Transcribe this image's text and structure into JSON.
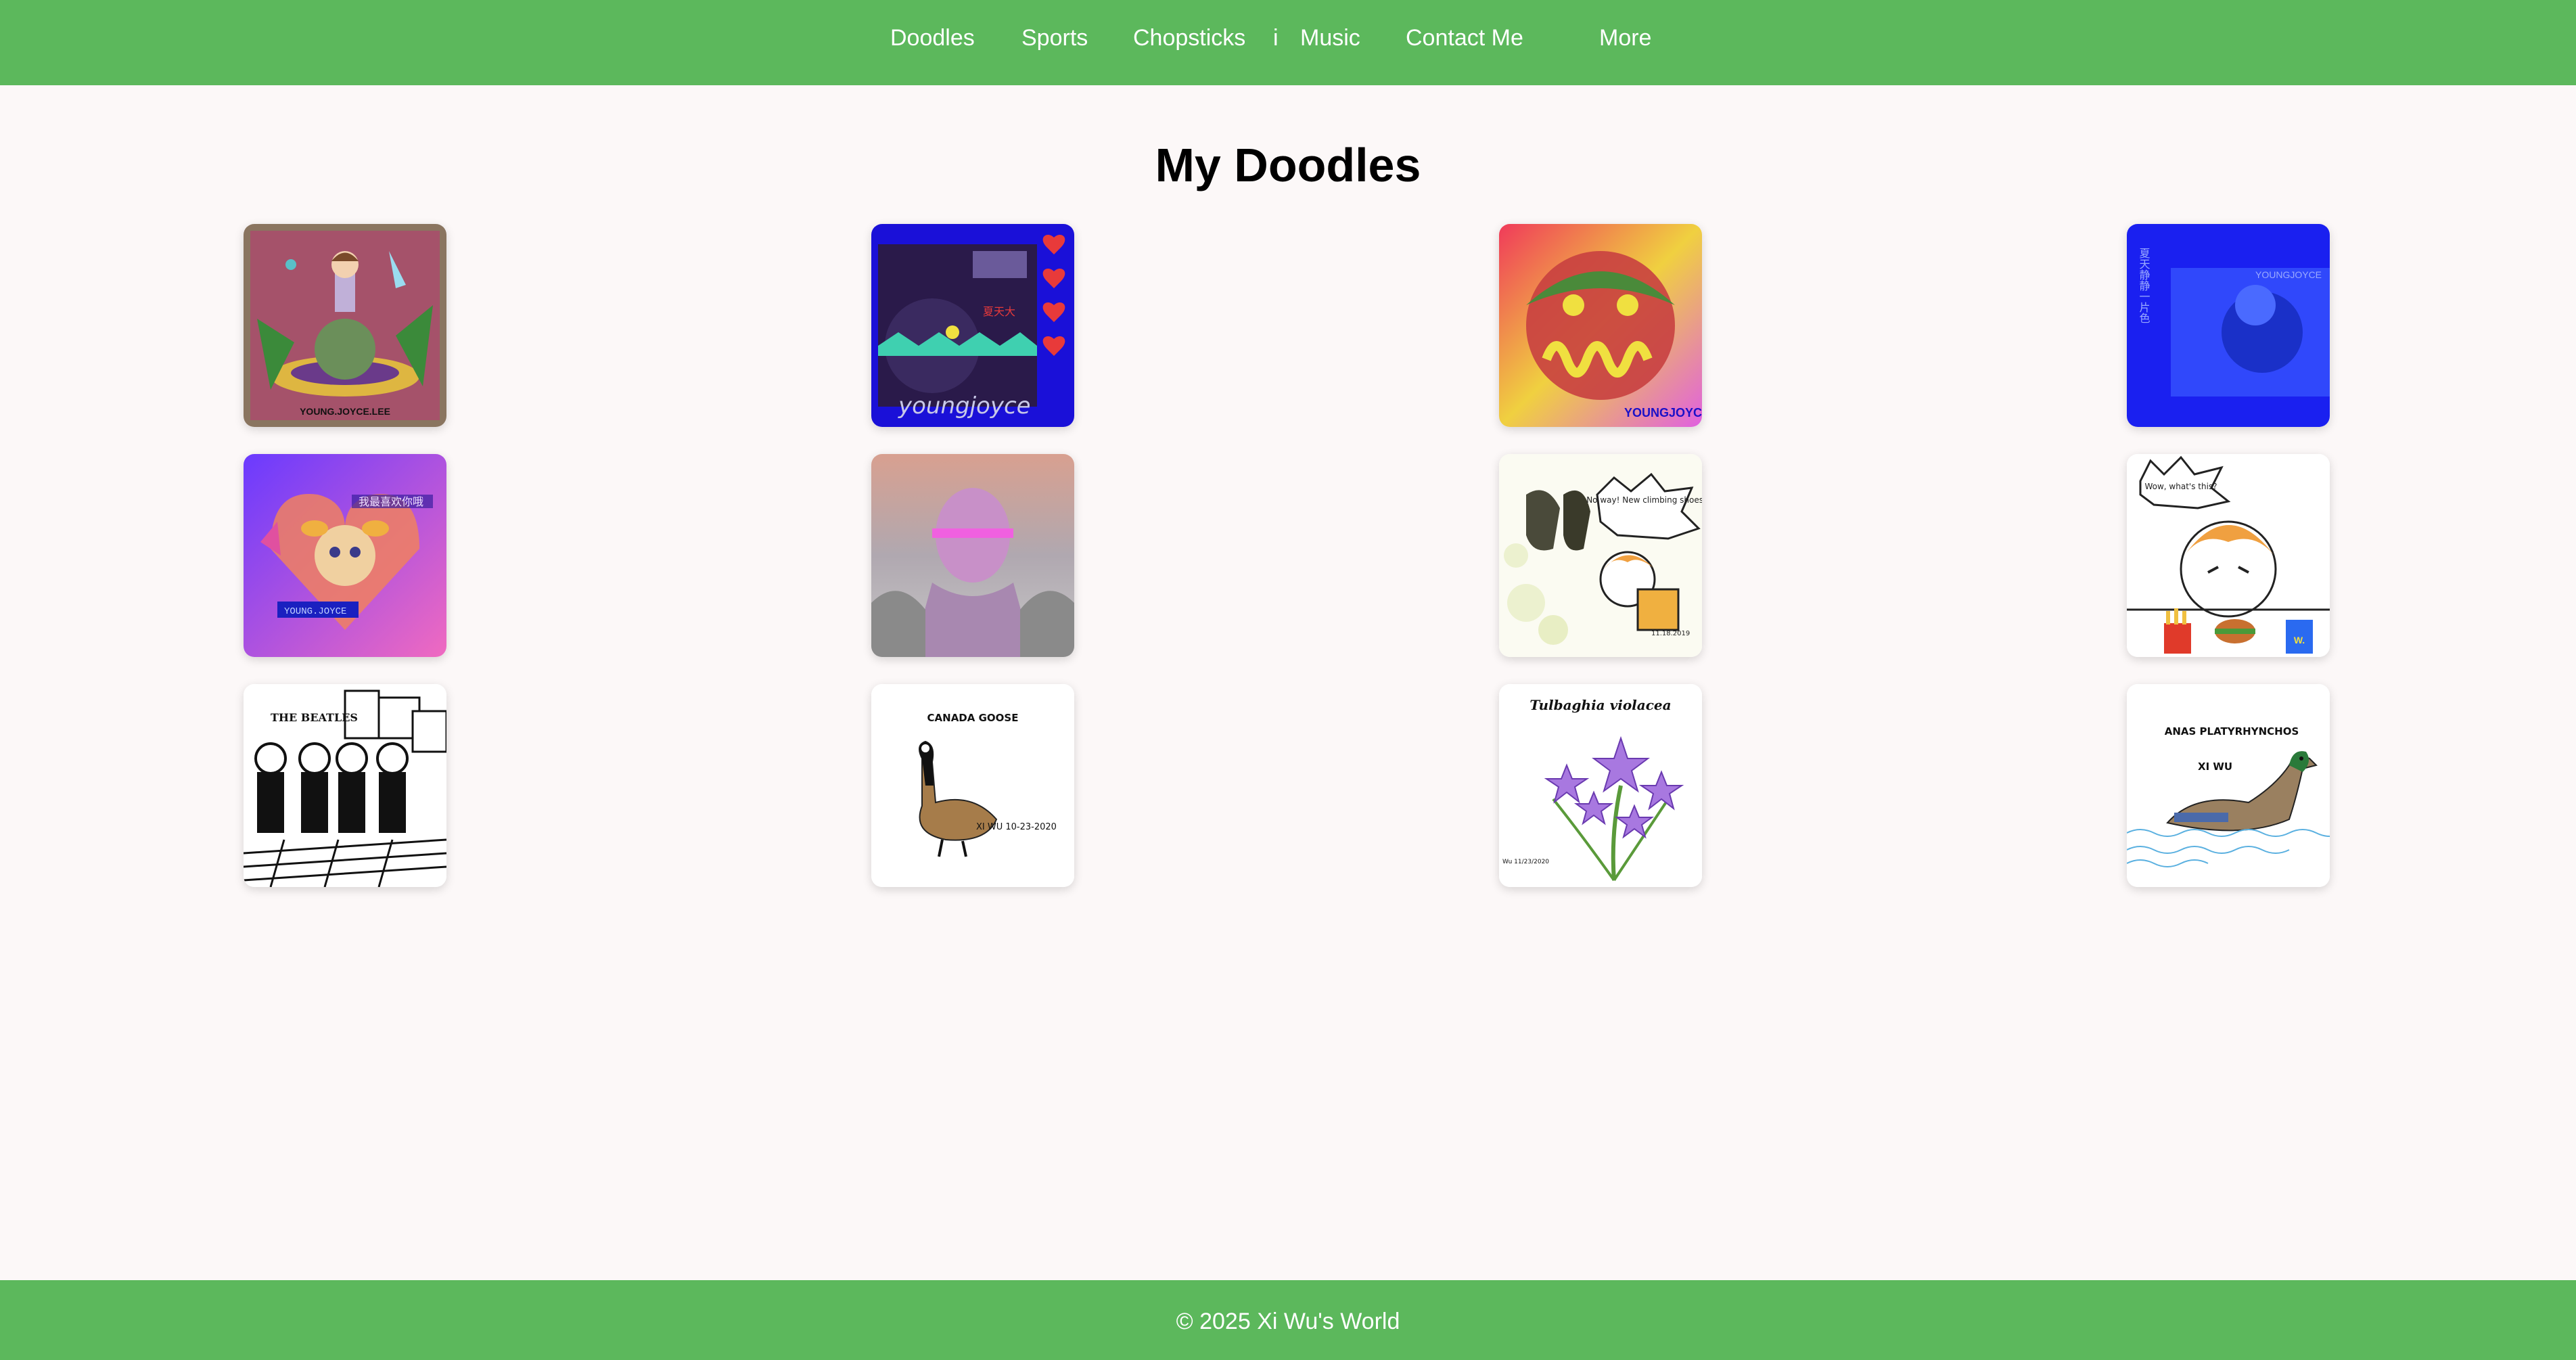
{
  "nav": {
    "items": [
      {
        "label": "Doodles"
      },
      {
        "label": "Sports"
      },
      {
        "label": "Chopsticks"
      },
      {
        "label": "Music"
      },
      {
        "label": "Contact Me"
      },
      {
        "label": "More"
      }
    ],
    "separator": "i"
  },
  "page": {
    "title": "My Doodles"
  },
  "gallery": {
    "items": [
      {
        "caption": "YOUNG.JOYCE.LEE"
      },
      {
        "caption": "youngjoyce",
        "side_text": "夏天大"
      },
      {
        "caption": "YOUNGJOYCE"
      },
      {
        "caption": "YOUNGJOYCE",
        "side_text": "夏天静静一片色"
      },
      {
        "caption": "YOUNG.JOYCE",
        "side_text": "我最喜欢你哦"
      },
      {
        "caption": ""
      },
      {
        "speech": "No way! New climbing shoes!",
        "date": "11.18.2019"
      },
      {
        "speech": "Wow, what's this?",
        "badge": "W."
      },
      {
        "caption": "THE BEATLES"
      },
      {
        "title": "CANADA GOOSE",
        "signature": "XI WU 10-23-2020"
      },
      {
        "title": "Tulbaghia violacea",
        "signature": "Wu 11/23/2020"
      },
      {
        "title": "ANAS PLATYRHYNCHOS",
        "signature": "XI WU"
      }
    ]
  },
  "footer": {
    "text": "© 2025 Xi Wu's World"
  },
  "colors": {
    "nav_bg": "#5cb85c",
    "page_bg": "#fcf8f8",
    "nav_text": "#ffffff"
  }
}
